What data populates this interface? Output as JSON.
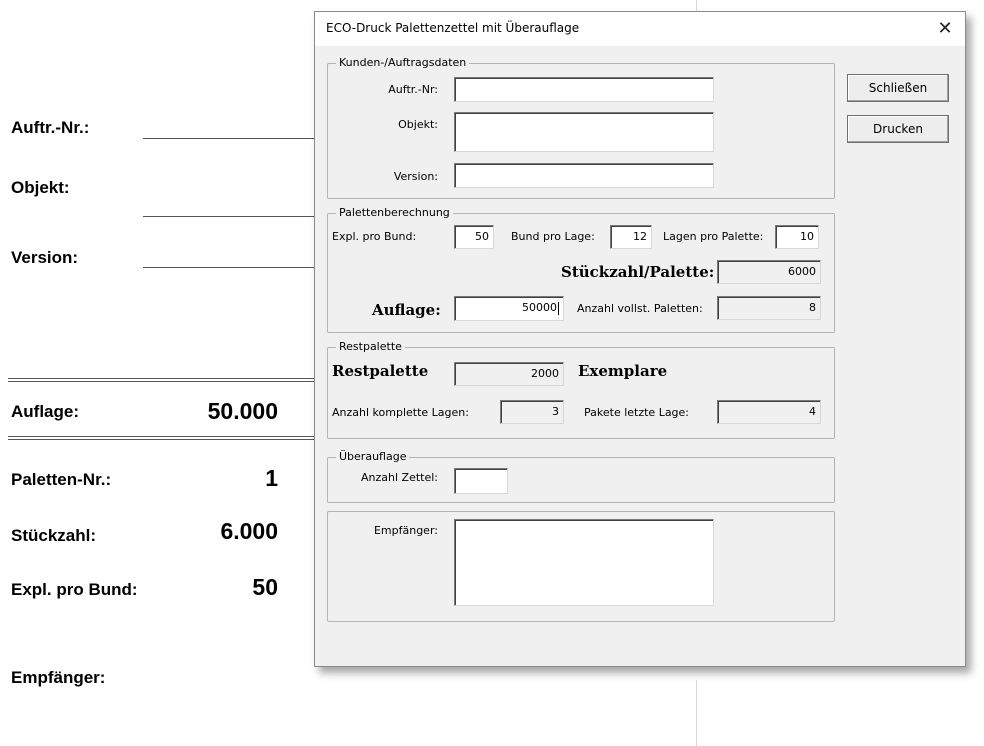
{
  "background": {
    "labels": {
      "order_no": "Auftr.-Nr.:",
      "object": "Objekt:",
      "version": "Version:",
      "edition": "Auflage:",
      "pallet_no": "Paletten-Nr.:",
      "quantity": "Stückzahl:",
      "copies_per_bundle": "Expl. pro Bund:",
      "recipient": "Empfänger:"
    },
    "values": {
      "edition": "50.000",
      "pallet_no": "1",
      "quantity": "6.000",
      "copies_per_bundle": "50"
    }
  },
  "dialog": {
    "title": "ECO-Druck Palettenzettel mit Überauflage",
    "close_glyph": "✕",
    "buttons": {
      "close": "Schließen",
      "print": "Drucken"
    },
    "customer": {
      "caption": "Kunden-/Auftragsdaten",
      "order_label": "Auftr.-Nr:",
      "order_value": "",
      "object_label": "Objekt:",
      "object_value": "",
      "version_label": "Version:",
      "version_value": ""
    },
    "pallet_calc": {
      "caption": "Palettenberechnung",
      "copies_per_bundle_label": "Expl. pro Bund:",
      "copies_per_bundle": "50",
      "bundles_per_layer_label": "Bund pro Lage:",
      "bundles_per_layer": "12",
      "layers_per_pallet_label": "Lagen pro Palette:",
      "layers_per_pallet": "10",
      "pieces_per_pallet_label": "Stückzahl/Palette:",
      "pieces_per_pallet": "6000",
      "edition_label": "Auflage:",
      "edition": "50000",
      "full_pallets_label": "Anzahl vollst. Paletten:",
      "full_pallets": "8"
    },
    "rest_pallet": {
      "caption": "Restpalette",
      "rest_label": "Restpalette",
      "rest_value": "2000",
      "rest_unit": "Exemplare",
      "complete_layers_label": "Anzahl komplette Lagen:",
      "complete_layers": "3",
      "packages_last_layer_label": "Pakete letzte Lage:",
      "packages_last_layer": "4"
    },
    "overrun": {
      "caption": "Überauflage",
      "slip_count_label": "Anzahl Zettel:",
      "slip_count": ""
    },
    "recipient": {
      "label": "Empfänger:",
      "value": ""
    }
  }
}
